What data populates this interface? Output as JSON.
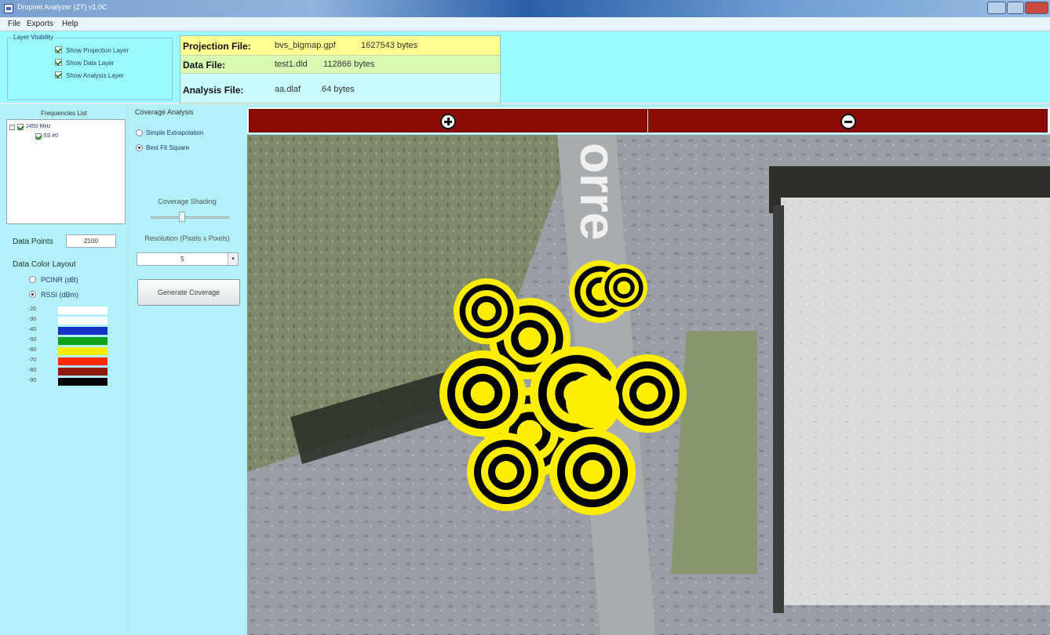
{
  "window": {
    "title": "Dropnet Analyzer (ZT) v1.0C"
  },
  "menu": {
    "file": "File",
    "exports": "Exports",
    "help": "Help"
  },
  "layer_visibility": {
    "title": "Layer Visibility",
    "items": [
      {
        "label": "Show Projection Layer",
        "checked": true
      },
      {
        "label": "Show Data Layer",
        "checked": true
      },
      {
        "label": "Show Analysis Layer",
        "checked": true
      }
    ]
  },
  "files": {
    "projection": {
      "label": "Projection File:",
      "name": "bvs_bigmap.gpf",
      "size": "1627543 bytes"
    },
    "data": {
      "label": "Data File:",
      "name": "test1.dld",
      "size": "112866 bytes"
    },
    "analysis": {
      "label": "Analysis File:",
      "name": "aa.dlaf",
      "size": "64 bytes"
    }
  },
  "frequencies": {
    "title": "Frequencies List",
    "items": [
      {
        "label": "2450 MHz",
        "checked": true,
        "expander": "-"
      },
      {
        "label": "SS #0",
        "checked": true
      }
    ]
  },
  "data_points": {
    "label": "Data Points",
    "value": "2100"
  },
  "data_color_layout": {
    "title": "Data Color Layout",
    "options": [
      {
        "label": "PCINR (dB)",
        "selected": false
      },
      {
        "label": "RSSI (dBm)",
        "selected": true
      }
    ]
  },
  "legend": [
    {
      "label": "-20",
      "color": "#ffffff"
    },
    {
      "label": "-30",
      "color": "#ffffff"
    },
    {
      "label": "-40",
      "color": "#1432c8"
    },
    {
      "label": "-50",
      "color": "#13a11a"
    },
    {
      "label": "-60",
      "color": "#f5ec0a"
    },
    {
      "label": "-70",
      "color": "#ff2a00"
    },
    {
      "label": "-80",
      "color": "#8c1a0a"
    },
    {
      "label": "-90",
      "color": "#000000"
    }
  ],
  "coverage": {
    "title": "Coverage Analysis",
    "options": [
      {
        "label": "Simple Extrapolation",
        "selected": false
      },
      {
        "label": "Best Fit Square",
        "selected": true
      }
    ],
    "shading_label": "Coverage Shading",
    "shading_level": 0.4,
    "resolution_label": "Resolution (Pixels x Pixels)",
    "resolution_value": "5",
    "generate_label": "Generate Coverage"
  },
  "map": {
    "street_text": "orre"
  },
  "colors": {
    "panel": "#b2f1fa",
    "top_panel": "#99fbff",
    "zoom_button": "#8b0c05",
    "coverage_yellow": "#ffee00",
    "coverage_black": "#000000"
  }
}
